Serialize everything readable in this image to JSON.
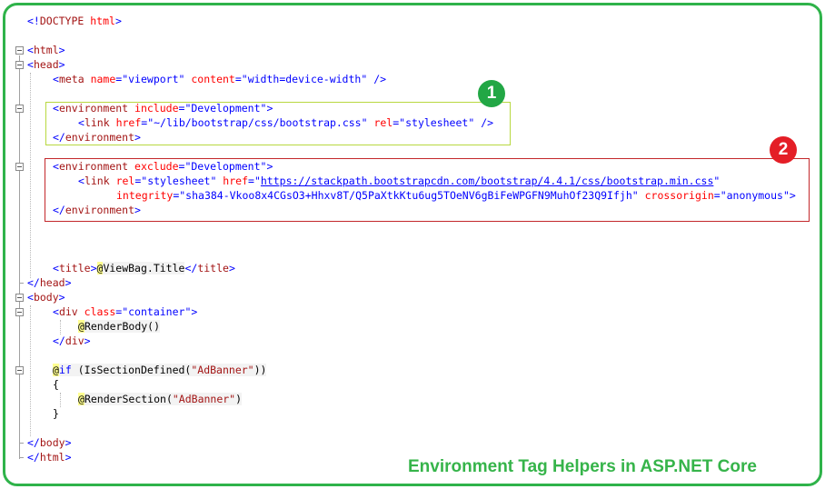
{
  "badges": {
    "one": "1",
    "two": "2"
  },
  "caption": {
    "word1": "Environment",
    "word2": "Tag Helpers in ASP.NET Core"
  },
  "code": {
    "doctype": {
      "open": "<!",
      "kw": "DOCTYPE",
      "val": " html",
      "close": ">"
    },
    "html_open": {
      "lt": "<",
      "tag": "html",
      "gt": ">"
    },
    "head_open": {
      "lt": "<",
      "tag": "head",
      "gt": ">"
    },
    "meta": {
      "lt": "<",
      "tag": "meta",
      "a1": " name",
      "eq1": "=",
      "v1": "\"viewport\"",
      "a2": " content",
      "eq2": "=",
      "v2": "\"width=device-width\"",
      "end": " />"
    },
    "env1_open": {
      "lt": "<",
      "tag": "environment",
      "a1": " include",
      "eq1": "=",
      "v1": "\"Development\"",
      "gt": ">"
    },
    "link1": {
      "lt": "<",
      "tag": "link",
      "a1": " href",
      "eq1": "=",
      "v1": "\"~/lib/bootstrap/css/bootstrap.css\"",
      "a2": " rel",
      "eq2": "=",
      "v2": "\"stylesheet\"",
      "end": " />"
    },
    "env1_close": {
      "lt": "</",
      "tag": "environment",
      "gt": ">"
    },
    "env2_open": {
      "lt": "<",
      "tag": "environment",
      "a1": " exclude",
      "eq1": "=",
      "v1": "\"Development\"",
      "gt": ">"
    },
    "link2": {
      "lt": "<",
      "tag": "link",
      "a1": " rel",
      "eq1": "=",
      "v1": "\"stylesheet\"",
      "a2": " href",
      "eq2": "=",
      "q1": "\"",
      "url": "https://stackpath.bootstrapcdn.com/bootstrap/4.4.1/css/bootstrap.min.css",
      "q2": "\""
    },
    "integrity": {
      "a1": "integrity",
      "eq1": "=",
      "v1": "\"sha384-Vkoo8x4CGsO3+Hhxv8T/Q5PaXtkKtu6ug5TOeNV6gBiFeWPGFN9MuhOf23Q9Ifjh\"",
      "a2": " crossorigin",
      "eq2": "=",
      "v2": "\"anonymous\"",
      "gt": ">"
    },
    "env2_close": {
      "lt": "</",
      "tag": "environment",
      "gt": ">"
    },
    "title": {
      "lt": "<",
      "tag": "title",
      "gt": ">",
      "at": "@",
      "expr": "ViewBag.Title",
      "lt2": "</",
      "tag2": "title",
      "gt2": ">"
    },
    "head_close": {
      "lt": "</",
      "tag": "head",
      "gt": ">"
    },
    "body_open": {
      "lt": "<",
      "tag": "body",
      "gt": ">"
    },
    "div_open": {
      "lt": "<",
      "tag": "div",
      "a1": " class",
      "eq1": "=",
      "v1": "\"container\"",
      "gt": ">"
    },
    "render_body": {
      "at": "@",
      "expr": "RenderBody()"
    },
    "div_close": {
      "lt": "</",
      "tag": "div",
      "gt": ">"
    },
    "if_line": {
      "at": "@",
      "kw": "if",
      "rest1": " (IsSectionDefined(",
      "str": "\"AdBanner\"",
      "rest2": "))"
    },
    "brace_open": "{",
    "render_section": {
      "at": "@",
      "expr": "RenderSection(",
      "str": "\"AdBanner\"",
      "close": ")"
    },
    "brace_close": "}",
    "body_close": {
      "lt": "</",
      "tag": "body",
      "gt": ">"
    },
    "html_close": {
      "lt": "</",
      "tag": "html",
      "gt": ">"
    }
  }
}
